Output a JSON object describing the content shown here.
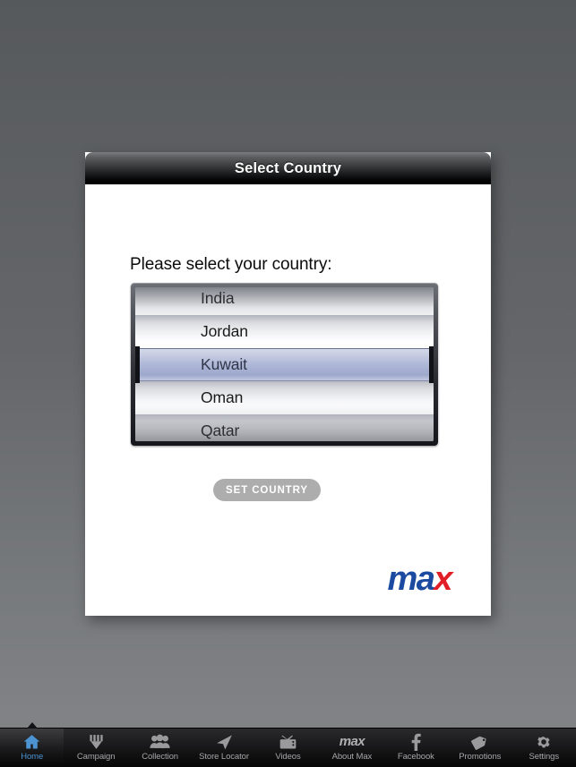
{
  "dialog": {
    "title": "Select Country",
    "prompt": "Please select your country:",
    "button_label": "SET COUNTRY",
    "logo_part1": "ma",
    "logo_part2": "x",
    "logo_color_blue": "#1b4aa0",
    "logo_color_red": "#e01f26"
  },
  "picker": {
    "options": [
      "India",
      "Jordan",
      "Kuwait",
      "Oman",
      "Qatar"
    ],
    "selected": "Kuwait",
    "selected_index": 2,
    "rows": [
      {
        "label": "India"
      },
      {
        "label": "Jordan"
      },
      {
        "label": "Kuwait"
      },
      {
        "label": "Oman"
      },
      {
        "label": "Qatar"
      }
    ]
  },
  "tabbar": {
    "selected_index": 0,
    "items": [
      {
        "label": "Home",
        "icon": "house-icon"
      },
      {
        "label": "Campaign",
        "icon": "medal-icon"
      },
      {
        "label": "Collection",
        "icon": "people-icon"
      },
      {
        "label": "Store Locator",
        "icon": "navigation-arrow-icon"
      },
      {
        "label": "Videos",
        "icon": "television-icon"
      },
      {
        "label": "About Max",
        "icon": "max-wordmark-icon"
      },
      {
        "label": "Facebook",
        "icon": "facebook-f-icon"
      },
      {
        "label": "Promotions",
        "icon": "price-tag-icon"
      },
      {
        "label": "Settings",
        "icon": "gear-icon"
      }
    ]
  },
  "theme": {
    "background_top": "#56595c",
    "background_bottom": "#808285",
    "accent_selected_tab": "#4b93d1",
    "button_gray": "#adadad"
  }
}
